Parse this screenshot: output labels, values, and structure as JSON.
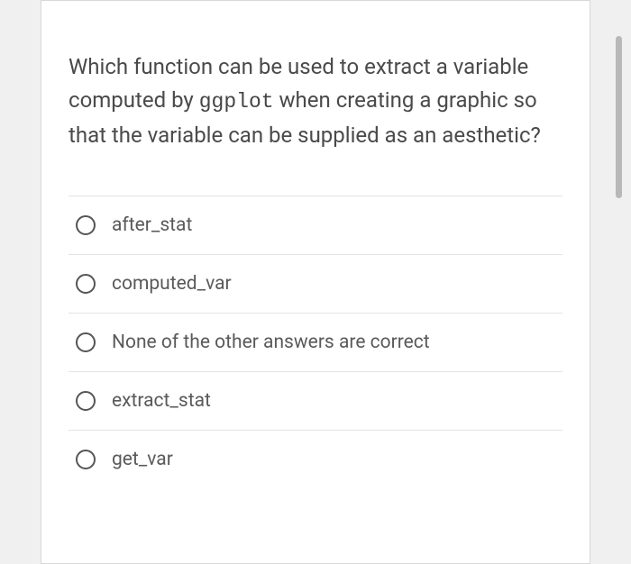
{
  "question": {
    "pre": "Which function can be used to extract a variable computed by ",
    "code": "ggplot",
    "post": " when creating a graphic so that the variable can be supplied as an aesthetic?"
  },
  "options": [
    {
      "label": "after_stat"
    },
    {
      "label": "computed_var"
    },
    {
      "label": "None of the other answers are correct"
    },
    {
      "label": "extract_stat"
    },
    {
      "label": "get_var"
    }
  ]
}
